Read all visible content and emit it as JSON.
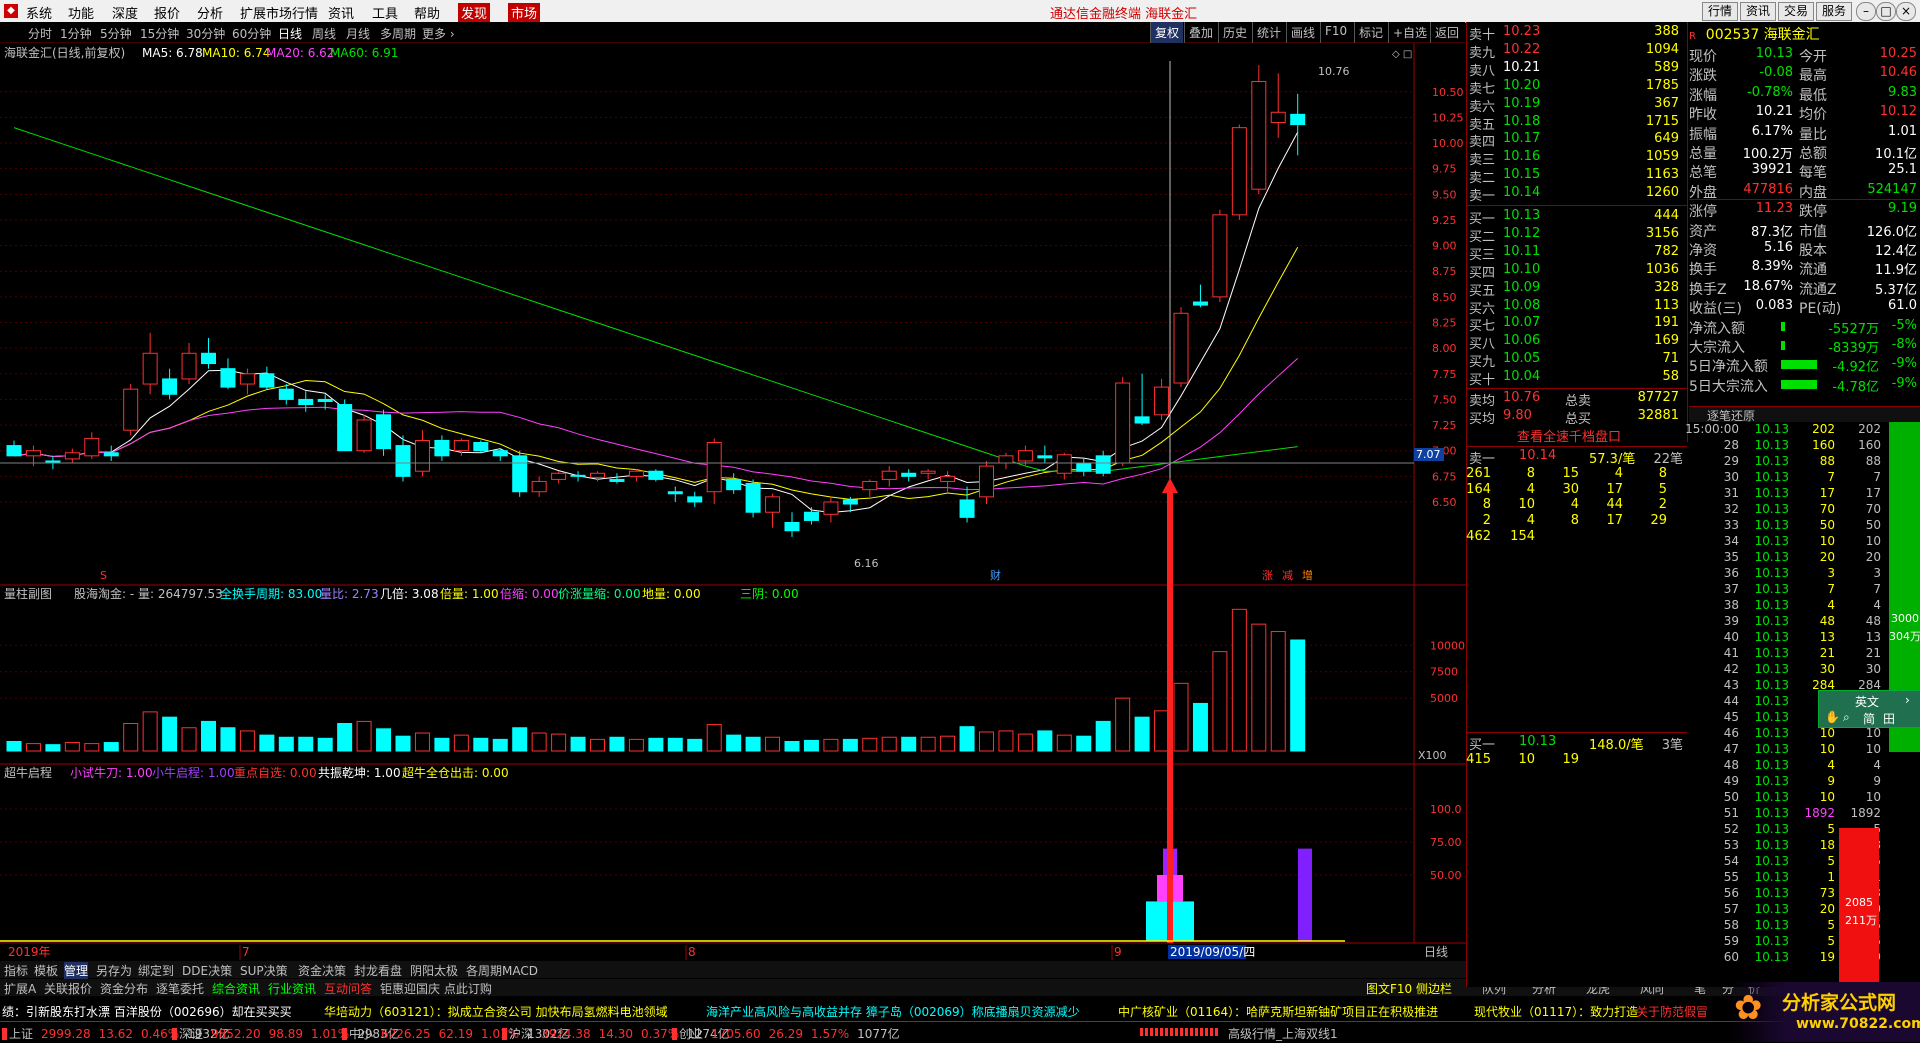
{
  "menu": [
    "系统",
    "功能",
    "深度",
    "报价",
    "分析",
    "扩展市场行情",
    "资讯",
    "工具",
    "帮助"
  ],
  "menu_hl": [
    "发现",
    "市场"
  ],
  "app_title": "通达信金融终端  海联金汇",
  "win_buttons": [
    "行情",
    "资讯",
    "交易",
    "服务"
  ],
  "periods": [
    "分时",
    "1分钟",
    "5分钟",
    "15分钟",
    "30分钟",
    "60分钟",
    "日线",
    "周线",
    "月线",
    "多周期",
    "更多"
  ],
  "active_period": "日线",
  "right_tools": [
    "复权",
    "叠加",
    "历史",
    "统计",
    "画线",
    "F10",
    "标记",
    "+自选",
    "返回"
  ],
  "main_chart": {
    "header": "海联金汇(日线,前复权)",
    "ma5": "MA5: 6.78",
    "ma10": "MA10: 6.74",
    "ma20": "MA20: 6.62",
    "ma60": "MA60: 6.91",
    "high_label": "10.76",
    "low_label": "6.16",
    "price_tag": "7.07",
    "axis": [
      "10.50",
      "10.25",
      "10.00",
      "9.75",
      "9.50",
      "9.25",
      "9.00",
      "8.75",
      "8.50",
      "8.25",
      "8.00",
      "7.75",
      "7.50",
      "7.25",
      "7.00",
      "6.75",
      "6.50"
    ],
    "marks": {
      "s": "S",
      "cai": "财",
      "zhang": "涨",
      "jian": "减",
      "zeng": "增"
    }
  },
  "vol_chart": {
    "name": "量柱副图",
    "text1": "股海淘金: - 量: 264797.53",
    "text2": "全换手周期: 83.00",
    "text3": "量比: 2.73",
    "text4": "几倍: 3.08",
    "text5": "倍量: 1.00",
    "text6": "倍缩: 0.00",
    "text7": "价涨量缩: 0.00",
    "text8": "地量: 0.00",
    "text9": "三阴: 0.00",
    "axis": [
      "10000",
      "7500",
      "5000"
    ],
    "unit": "X100"
  },
  "ind_chart": {
    "name": "超牛启程",
    "t1": "小试牛刀: 1.00",
    "t2": "小牛启程: 1.00",
    "t3": "重点自选: 0.00",
    "t4": "共振乾坤: 1.00",
    "t5": "超牛全仓出击: 0.00",
    "axis": [
      "100.0",
      "75.00",
      "50.00"
    ]
  },
  "date_axis": {
    "year": "2019年",
    "m7": "7",
    "m8": "8",
    "m9": "9",
    "cursor": "2019/09/05/四",
    "period": "日线"
  },
  "chart_data": {
    "type": "candlestick",
    "ohlc": [
      [
        7.05,
        7.1,
        6.95,
        6.95
      ],
      [
        6.95,
        7.05,
        6.85,
        7.0
      ],
      [
        6.9,
        6.95,
        6.82,
        6.88
      ],
      [
        6.92,
        7.02,
        6.88,
        6.98
      ],
      [
        6.95,
        7.18,
        6.92,
        7.12
      ],
      [
        6.98,
        7.05,
        6.9,
        6.95
      ],
      [
        7.2,
        7.65,
        7.15,
        7.6
      ],
      [
        7.65,
        8.15,
        7.55,
        7.95
      ],
      [
        7.7,
        7.8,
        7.5,
        7.55
      ],
      [
        7.7,
        8.05,
        7.65,
        7.95
      ],
      [
        7.95,
        8.1,
        7.8,
        7.85
      ],
      [
        7.8,
        7.9,
        7.6,
        7.62
      ],
      [
        7.65,
        7.8,
        7.55,
        7.75
      ],
      [
        7.75,
        7.82,
        7.6,
        7.62
      ],
      [
        7.6,
        7.65,
        7.45,
        7.5
      ],
      [
        7.5,
        7.58,
        7.38,
        7.45
      ],
      [
        7.5,
        7.55,
        7.4,
        7.48
      ],
      [
        7.45,
        7.5,
        7.0,
        7.0
      ],
      [
        7.0,
        7.35,
        6.98,
        7.3
      ],
      [
        7.35,
        7.4,
        6.95,
        7.02
      ],
      [
        7.05,
        7.15,
        6.7,
        6.75
      ],
      [
        6.8,
        7.2,
        6.75,
        7.1
      ],
      [
        7.1,
        7.15,
        6.9,
        6.95
      ],
      [
        7.0,
        7.12,
        6.95,
        7.1
      ],
      [
        7.08,
        7.1,
        6.98,
        7.0
      ],
      [
        7.0,
        7.02,
        6.9,
        6.95
      ],
      [
        6.95,
        7.0,
        6.55,
        6.6
      ],
      [
        6.6,
        6.75,
        6.55,
        6.7
      ],
      [
        6.72,
        6.8,
        6.68,
        6.78
      ],
      [
        6.76,
        6.8,
        6.7,
        6.75
      ],
      [
        6.74,
        6.8,
        6.7,
        6.78
      ],
      [
        6.72,
        6.78,
        6.68,
        6.7
      ],
      [
        6.75,
        6.82,
        6.7,
        6.8
      ],
      [
        6.8,
        6.82,
        6.7,
        6.72
      ],
      [
        6.6,
        6.65,
        6.5,
        6.58
      ],
      [
        6.55,
        6.6,
        6.45,
        6.5
      ],
      [
        6.6,
        7.12,
        6.48,
        7.08
      ],
      [
        6.72,
        6.78,
        6.58,
        6.62
      ],
      [
        6.68,
        6.72,
        6.35,
        6.4
      ],
      [
        6.4,
        6.58,
        6.25,
        6.55
      ],
      [
        6.3,
        6.4,
        6.16,
        6.22
      ],
      [
        6.4,
        6.45,
        6.28,
        6.32
      ],
      [
        6.38,
        6.55,
        6.3,
        6.5
      ],
      [
        6.52,
        6.55,
        6.4,
        6.48
      ],
      [
        6.62,
        6.72,
        6.55,
        6.7
      ],
      [
        6.72,
        6.85,
        6.65,
        6.8
      ],
      [
        6.78,
        6.82,
        6.7,
        6.75
      ],
      [
        6.78,
        6.82,
        6.72,
        6.8
      ],
      [
        6.7,
        6.8,
        6.6,
        6.75
      ],
      [
        6.52,
        6.65,
        6.3,
        6.35
      ],
      [
        6.55,
        6.9,
        6.48,
        6.85
      ],
      [
        6.88,
        6.98,
        6.82,
        6.95
      ],
      [
        6.9,
        7.05,
        6.86,
        7.0
      ],
      [
        6.95,
        7.05,
        6.88,
        6.93
      ],
      [
        6.78,
        6.98,
        6.72,
        6.96
      ],
      [
        6.88,
        6.92,
        6.75,
        6.8
      ],
      [
        6.95,
        7.0,
        6.75,
        6.78
      ],
      [
        6.88,
        7.72,
        6.85,
        7.66
      ],
      [
        7.33,
        7.75,
        7.25,
        7.27
      ],
      [
        7.35,
        7.7,
        7.3,
        7.62
      ],
      [
        7.66,
        8.4,
        7.62,
        8.34
      ],
      [
        8.45,
        8.62,
        8.4,
        8.42
      ],
      [
        8.5,
        9.35,
        8.45,
        9.3
      ],
      [
        9.3,
        10.18,
        9.25,
        10.15
      ],
      [
        9.55,
        10.76,
        9.5,
        10.6
      ],
      [
        10.2,
        10.68,
        10.05,
        10.3
      ],
      [
        10.28,
        10.48,
        9.88,
        10.18
      ]
    ],
    "volume": [
      900,
      700,
      600,
      800,
      700,
      800,
      2600,
      3700,
      3200,
      2200,
      2800,
      2200,
      1900,
      1500,
      1300,
      1300,
      1200,
      2600,
      2800,
      2100,
      1400,
      1700,
      1200,
      1500,
      1200,
      1100,
      2200,
      1700,
      1600,
      1300,
      1100,
      1300,
      1100,
      1200,
      1200,
      1100,
      2500,
      1500,
      1300,
      1300,
      900,
      1000,
      1100,
      1100,
      1200,
      1300,
      1300,
      1300,
      1400,
      2300,
      1800,
      1900,
      1600,
      1900,
      1500,
      1400,
      2800,
      5000,
      3200,
      3800,
      6400,
      4500,
      9400,
      13400,
      12000,
      11300,
      10500
    ],
    "indicator_bars": [
      {
        "x": "2019/09/05",
        "segments": [
          [
            "cyan",
            30
          ],
          [
            "mag",
            50
          ],
          [
            "purple",
            70
          ]
        ]
      },
      {
        "x": "later",
        "segments": [
          [
            "purple",
            70
          ]
        ]
      }
    ]
  },
  "quote": {
    "code": "002537 海联金汇",
    "asks": [
      [
        "卖十",
        "10.23",
        "388"
      ],
      [
        "卖九",
        "10.22",
        "1094"
      ],
      [
        "卖八",
        "10.21",
        "589"
      ],
      [
        "卖七",
        "10.20",
        "1785"
      ],
      [
        "卖六",
        "10.19",
        "367"
      ],
      [
        "卖五",
        "10.18",
        "1715"
      ],
      [
        "卖四",
        "10.17",
        "649"
      ],
      [
        "卖三",
        "10.16",
        "1059"
      ],
      [
        "卖二",
        "10.15",
        "1163"
      ],
      [
        "卖一",
        "10.14",
        "1260"
      ]
    ],
    "bids": [
      [
        "买一",
        "10.13",
        "444"
      ],
      [
        "买二",
        "10.12",
        "3156"
      ],
      [
        "买三",
        "10.11",
        "782"
      ],
      [
        "买四",
        "10.10",
        "1036"
      ],
      [
        "买五",
        "10.09",
        "328"
      ],
      [
        "买六",
        "10.08",
        "113"
      ],
      [
        "买七",
        "10.07",
        "191"
      ],
      [
        "买八",
        "10.06",
        "169"
      ],
      [
        "买九",
        "10.05",
        "71"
      ],
      [
        "买十",
        "10.04",
        "58"
      ]
    ],
    "avg_sell": [
      "卖均",
      "10.76",
      "总卖",
      "87727"
    ],
    "avg_buy": [
      "买均",
      "9.80",
      "总买",
      "32881"
    ],
    "stats": [
      [
        "现价",
        "10.13",
        "今开",
        "10.25"
      ],
      [
        "涨跌",
        "-0.08",
        "最高",
        "10.46"
      ],
      [
        "涨幅",
        "-0.78%",
        "最低",
        "9.83"
      ],
      [
        "昨收",
        "10.21",
        "均价",
        "10.12"
      ],
      [
        "振幅",
        "6.17%",
        "量比",
        "1.01"
      ],
      [
        "总量",
        "100.2万",
        "总额",
        "10.1亿"
      ],
      [
        "总笔",
        "39921",
        "每笔",
        "25.1"
      ],
      [
        "外盘",
        "477816",
        "内盘",
        "524147"
      ],
      [
        "涨停",
        "11.23",
        "跌停",
        "9.19"
      ],
      [
        "资产",
        "87.3亿",
        "市值",
        "126.0亿"
      ],
      [
        "净资",
        "5.16",
        "股本",
        "12.4亿"
      ],
      [
        "换手",
        "8.39%",
        "流通",
        "11.9亿"
      ],
      [
        "换手Z",
        "18.67%",
        "流通Z",
        "5.37亿"
      ],
      [
        "收益(三)",
        "0.083",
        "PE(动)",
        "61.0"
      ],
      [
        "净流入额",
        "",
        "-5527万",
        "-5%"
      ],
      [
        "大宗流入",
        "",
        "-8339万",
        "-8%"
      ],
      [
        "5日净流入额",
        "",
        "-4.92亿",
        "-9%"
      ],
      [
        "5日大宗流入",
        "",
        "-4.78亿",
        "-9%"
      ]
    ],
    "l2_title": "查看全速千档盘口",
    "l2_sell": [
      "卖一",
      "10.14",
      "57.3/笔",
      "22笔"
    ],
    "l2_sell_rows": [
      [
        "261",
        "8",
        "15",
        "4",
        "8"
      ],
      [
        "164",
        "4",
        "30",
        "17",
        "5"
      ],
      [
        "8",
        "10",
        "4",
        "44",
        "2"
      ],
      [
        "2",
        "4",
        "8",
        "17",
        "29"
      ],
      [
        "462",
        "154",
        "",
        "",
        ""
      ]
    ],
    "l2_buy": [
      "买一",
      "10.13",
      "148.0/笔",
      "3笔"
    ],
    "l2_buy_rows": [
      [
        "415",
        "10",
        "19",
        "",
        ""
      ]
    ]
  },
  "ticks": {
    "title": "逐笔还原",
    "rows": [
      [
        "15:00:00",
        "10.13",
        "202",
        "202"
      ],
      [
        "28",
        "10.13",
        "160",
        "160"
      ],
      [
        "29",
        "10.13",
        "88",
        "88"
      ],
      [
        "30",
        "10.13",
        "7",
        "7"
      ],
      [
        "31",
        "10.13",
        "17",
        "17"
      ],
      [
        "32",
        "10.13",
        "70",
        "70"
      ],
      [
        "33",
        "10.13",
        "50",
        "50"
      ],
      [
        "34",
        "10.13",
        "10",
        "10"
      ],
      [
        "35",
        "10.13",
        "20",
        "20"
      ],
      [
        "36",
        "10.13",
        "3",
        "3"
      ],
      [
        "37",
        "10.13",
        "7",
        "7"
      ],
      [
        "38",
        "10.13",
        "4",
        "4"
      ],
      [
        "39",
        "10.13",
        "48",
        "48"
      ],
      [
        "40",
        "10.13",
        "13",
        "13"
      ],
      [
        "41",
        "10.13",
        "21",
        "21"
      ],
      [
        "42",
        "10.13",
        "30",
        "30"
      ],
      [
        "43",
        "10.13",
        "284",
        "284"
      ],
      [
        "44",
        "10.13",
        "15",
        "15"
      ],
      [
        "45",
        "10.13",
        "4",
        "4"
      ],
      [
        "46",
        "10.13",
        "10",
        "10"
      ],
      [
        "47",
        "10.13",
        "10",
        "10"
      ],
      [
        "48",
        "10.13",
        "4",
        "4"
      ],
      [
        "49",
        "10.13",
        "9",
        "9"
      ],
      [
        "50",
        "10.13",
        "10",
        "10"
      ],
      [
        "51",
        "10.13",
        "1892",
        "1892"
      ],
      [
        "52",
        "10.13",
        "5",
        "5"
      ],
      [
        "53",
        "10.13",
        "18",
        "18"
      ],
      [
        "54",
        "10.13",
        "5",
        "5"
      ],
      [
        "55",
        "10.13",
        "1",
        "1"
      ],
      [
        "56",
        "10.13",
        "73",
        "73"
      ],
      [
        "57",
        "10.13",
        "20",
        "20"
      ],
      [
        "58",
        "10.13",
        "5",
        "5"
      ],
      [
        "59",
        "10.13",
        "5",
        "5"
      ],
      [
        "60",
        "10.13",
        "19",
        "19"
      ]
    ],
    "bar_top": "3000",
    "bar_top2": "304万",
    "bar_bot": "2085",
    "bar_bot2": "211万"
  },
  "ime": {
    "t1": "英文",
    "t2": "简",
    "t3": "田"
  },
  "bottom_tabs1": [
    "指标",
    "模板",
    "管理",
    "另存为",
    "绑定到",
    "DDE决策",
    "SUP决策",
    "资金决策",
    "封龙看盘",
    "阴阳太极",
    "各周期MACD"
  ],
  "bottom_tabs2": [
    "扩展A",
    "关联报价",
    "资金分布",
    "逐笔委托",
    "综合资讯",
    "行业资讯",
    "互动问答",
    "钜惠迎国庆 点此订购"
  ],
  "bottom_right": [
    "图文F10",
    "侧边栏"
  ],
  "right_tabs": [
    "队列",
    "分析",
    "龙虎",
    "风向",
    "笔",
    "分",
    "价"
  ],
  "ticker": [
    "绩：引新股东打水漂 百洋股份（002696）却在买买买",
    "华培动力（603121）：拟成立合资公司 加快布局氢燃料电池领域",
    "海洋产业高风险与高收益并存 獐子岛（002069）称底播扇贝资源减少",
    "中广核矿业（01164）：哈萨克斯坦新铀矿项目正在积极推进",
    "现代牧业（01117）：致力打造",
    "关于防范假冒"
  ],
  "status": [
    {
      "name": "上证",
      "v": "2999.28",
      "c": "13.62",
      "p": "0.46%",
      "a": "1932亿"
    },
    {
      "name": "深证",
      "v": "9852.20",
      "c": "98.89",
      "p": "1.01%",
      "a": "2983亿"
    },
    {
      "name": "中小",
      "v": "6226.25",
      "c": "62.19",
      "p": "1.01%",
      "a": "1302亿"
    },
    {
      "name": "沪深",
      "v": "3924.38",
      "c": "14.30",
      "p": "0.37%",
      "a": "1274亿"
    },
    {
      "name": "创业",
      "v": "1705.60",
      "c": "26.29",
      "p": "1.57%",
      "a": "1077亿"
    }
  ],
  "status_right": "高级行情_上海双线1",
  "logo": {
    "t1": "分析家公式网",
    "t2": "www.70822.com"
  }
}
